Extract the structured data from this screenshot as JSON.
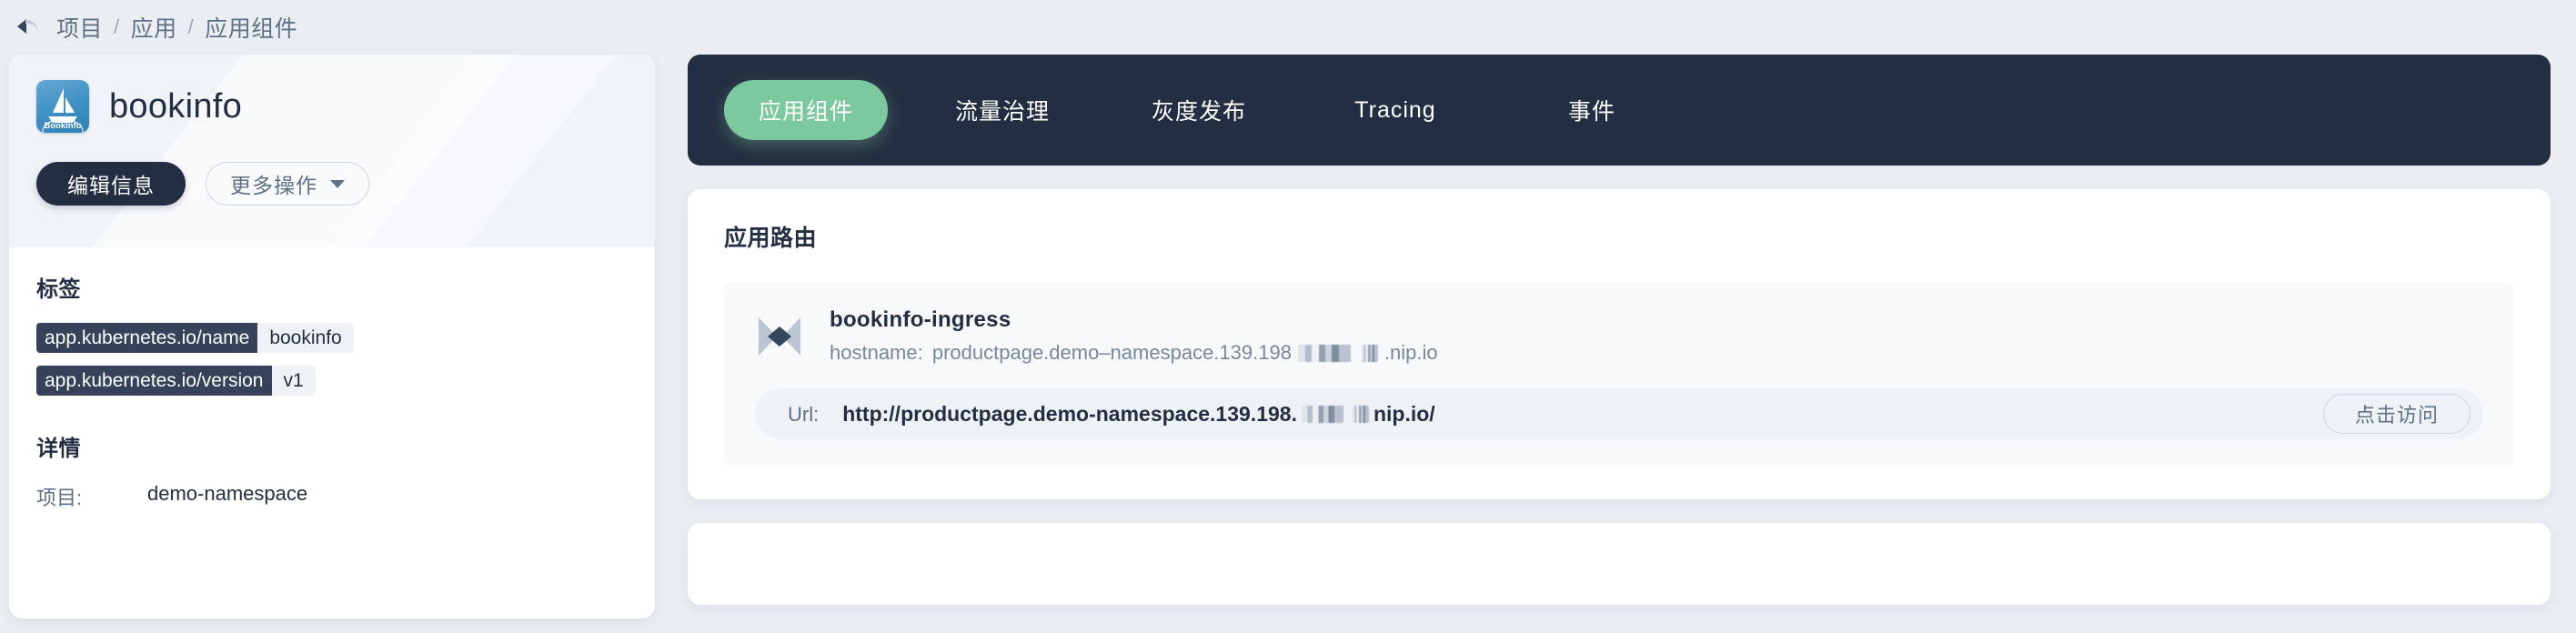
{
  "breadcrumb": {
    "back_icon": "back-arrow-icon",
    "items": [
      "项目",
      "应用",
      "应用组件"
    ],
    "separator": "/"
  },
  "sidebar": {
    "logo": {
      "icon": "bookinfo-sailboat-logo",
      "caption": "BookInfo"
    },
    "title": "bookinfo",
    "actions": {
      "edit_label": "编辑信息",
      "more_label": "更多操作",
      "more_caret_icon": "chevron-down-icon"
    },
    "labels_section": {
      "title": "标签",
      "chips": [
        {
          "key": "app.kubernetes.io/name",
          "value": "bookinfo"
        },
        {
          "key": "app.kubernetes.io/version",
          "value": "v1"
        }
      ]
    },
    "details_section": {
      "title": "详情",
      "rows": [
        {
          "key": "项目:",
          "value": "demo-namespace"
        }
      ]
    }
  },
  "tabs": [
    {
      "label": "应用组件",
      "active": true
    },
    {
      "label": "流量治理",
      "active": false
    },
    {
      "label": "灰度发布",
      "active": false
    },
    {
      "label": "Tracing",
      "active": false
    },
    {
      "label": "事件",
      "active": false
    }
  ],
  "main": {
    "panel_title": "应用路由",
    "route": {
      "icon": "ingress-bowtie-icon",
      "name": "bookinfo-ingress",
      "hostname_label": "hostname:",
      "hostname_prefix": "productpage.demo–namespace.139.198",
      "hostname_suffix": ".nip.io",
      "url_label": "Url:",
      "url_prefix": "http://productpage.demo-namespace.139.198.",
      "url_suffix": "nip.io/",
      "visit_label": "点击访问"
    }
  },
  "colors": {
    "page_bg": "#eaeef3",
    "card_bg": "#ffffff",
    "dark": "#242e42",
    "accent_green": "#7cc9a0",
    "muted_text": "#5f7085",
    "chip_key_bg": "#36415a",
    "chip_bg": "#eef1f6"
  }
}
